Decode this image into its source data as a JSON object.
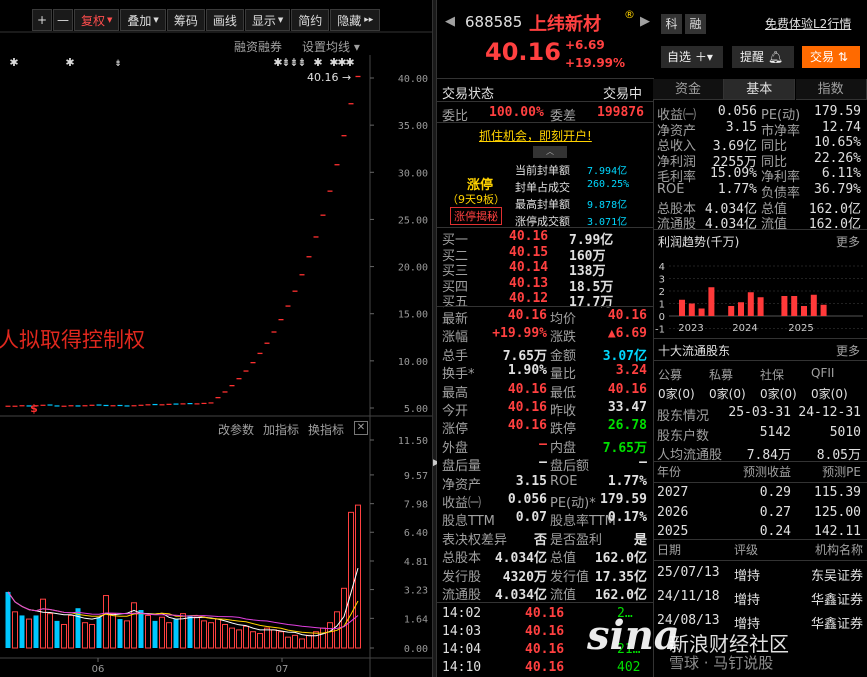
{
  "toolbar": {
    "add": "+",
    "minus": "—",
    "fuquan": "复权",
    "diejia": "叠加",
    "chouma": "筹码",
    "huaxian": "画线",
    "xianshi": "显示",
    "jianyue": "简约",
    "yincang": "隐藏",
    "more": "▸▸"
  },
  "chart": {
    "rzrq": "融资融券",
    "junxian": "设置均线",
    "price_label": "40.16",
    "annotation": "人拟取得控制权",
    "y_axis": [
      "40.00",
      "35.00",
      "30.00",
      "25.00",
      "20.00",
      "15.00",
      "10.00",
      "5.00"
    ],
    "sub_buttons": [
      "改参数",
      "加指标",
      "换指标"
    ],
    "sub_y_axis": [
      "11.50",
      "9.57",
      "7.98",
      "6.40",
      "4.81",
      "3.23",
      "1.64",
      "0.00"
    ],
    "x_labels": [
      "06",
      "07"
    ],
    "closes": [
      5.25,
      5.25,
      5.3,
      5.2,
      5.3,
      5.35,
      5.3,
      5.2,
      5.25,
      5.3,
      5.2,
      5.3,
      5.35,
      5.3,
      5.25,
      5.3,
      5.25,
      5.2,
      5.3,
      5.35,
      5.4,
      5.35,
      5.4,
      5.45,
      5.4,
      5.5,
      5.45,
      5.5,
      5.55,
      5.6,
      6.1,
      6.7,
      7.37,
      8.11,
      8.92,
      9.81,
      10.79,
      11.87,
      13.06,
      14.37,
      15.81,
      17.39,
      19.13,
      21.04,
      23.14,
      25.45,
      28.0,
      30.8,
      33.88,
      37.27,
      40.16
    ],
    "volumes": [
      3.1,
      2.0,
      1.8,
      1.6,
      1.8,
      2.7,
      1.9,
      1.5,
      1.3,
      1.8,
      2.2,
      1.4,
      1.3,
      1.7,
      2.9,
      1.9,
      1.6,
      1.5,
      2.5,
      2.1,
      1.8,
      1.5,
      1.7,
      1.4,
      1.6,
      1.9,
      1.8,
      1.7,
      1.5,
      1.4,
      1.6,
      1.3,
      1.1,
      1.0,
      1.2,
      0.9,
      0.8,
      1.1,
      1.0,
      0.9,
      0.6,
      0.7,
      0.5,
      0.7,
      0.9,
      1.1,
      1.4,
      2.0,
      3.3,
      7.5,
      7.9
    ],
    "vol_up": [
      false,
      true,
      false,
      true,
      false,
      true,
      true,
      false,
      true,
      true,
      false,
      true,
      true,
      false,
      true,
      true,
      false,
      true,
      true,
      false,
      true,
      false,
      true,
      true,
      false,
      true,
      false,
      true,
      true,
      true,
      true,
      true,
      true,
      true,
      true,
      true,
      true,
      true,
      true,
      true,
      true,
      true,
      true,
      true,
      true,
      true,
      true,
      true,
      true,
      true,
      true
    ]
  },
  "header": {
    "code": "688585",
    "name": "上纬新材",
    "ke": "科",
    "rong": "融",
    "free_l2": "免费体验L2行情",
    "price": "40.16",
    "change": "+6.69",
    "pct": "+19.99%",
    "zixuan": "自选",
    "tixing": "提醒",
    "jiaoyi": "交易"
  },
  "status": {
    "label": "交易状态",
    "value": "交易中",
    "weibi_l": "委比",
    "weibi_v": "100.00%",
    "weicha_l": "委差",
    "weicha_v": "199876",
    "promo": "抓住机会，即刻开户!"
  },
  "limit": {
    "title": "涨停",
    "sub": "（9天9板）",
    "btn": "涨停揭秘",
    "rows": [
      [
        "当前封单额",
        "7.994亿"
      ],
      [
        "封单占成交",
        "260.25%"
      ],
      [
        "最高封单额",
        "9.878亿"
      ],
      [
        "涨停成交额",
        "3.071亿"
      ]
    ]
  },
  "book": [
    [
      "买一",
      "40.16",
      "7.99亿"
    ],
    [
      "买二",
      "40.15",
      "160万"
    ],
    [
      "买三",
      "40.14",
      "138万"
    ],
    [
      "买四",
      "40.13",
      "18.5万"
    ],
    [
      "买五",
      "40.12",
      "17.7万"
    ]
  ],
  "stats": [
    [
      [
        "最新",
        "40.16",
        "r"
      ],
      [
        "均价",
        "40.16",
        "r"
      ]
    ],
    [
      [
        "涨幅",
        "+19.99%",
        "r"
      ],
      [
        "涨跌",
        "▲6.69",
        "r"
      ]
    ],
    [
      [
        "总手",
        "7.65万",
        "w"
      ],
      [
        "金额",
        "3.07亿",
        "c"
      ]
    ],
    [
      [
        "换手*",
        "1.90%",
        "w"
      ],
      [
        "量比",
        "3.24",
        "r"
      ]
    ],
    [
      [
        "最高",
        "40.16",
        "r"
      ],
      [
        "最低",
        "40.16",
        "r"
      ]
    ],
    [
      [
        "今开",
        "40.16",
        "r"
      ],
      [
        "昨收",
        "33.47",
        "w"
      ]
    ],
    [
      [
        "涨停",
        "40.16",
        "r"
      ],
      [
        "跌停",
        "26.78",
        "g"
      ]
    ],
    [
      [
        "外盘",
        "—",
        "r"
      ],
      [
        "内盘",
        "7.65万",
        "g"
      ]
    ],
    [
      [
        "盘后量",
        "—",
        "w"
      ],
      [
        "盘后额",
        "—",
        "w"
      ]
    ],
    [
      [
        "净资产",
        "3.15",
        "w"
      ],
      [
        "ROE",
        "1.77%",
        "w"
      ]
    ],
    [
      [
        "收益㈠",
        "0.056",
        "w"
      ],
      [
        "PE(动)*",
        "179.59",
        "w"
      ]
    ],
    [
      [
        "股息TTM",
        "0.07",
        "w"
      ],
      [
        "股息率TTM",
        "0.17%",
        "w"
      ]
    ],
    [
      [
        "表决权差异",
        "否",
        "w"
      ],
      [
        "是否盈利",
        "是",
        "w"
      ]
    ],
    [
      [
        "总股本",
        "4.034亿",
        "w"
      ],
      [
        "总值",
        "162.0亿",
        "w"
      ]
    ],
    [
      [
        "发行股",
        "4320万",
        "w"
      ],
      [
        "发行值",
        "17.35亿",
        "w"
      ]
    ],
    [
      [
        "流通股",
        "4.034亿",
        "w"
      ],
      [
        "流值",
        "162.0亿",
        "w"
      ]
    ]
  ],
  "ticks": [
    [
      "14:02",
      "40.16",
      "2…"
    ],
    [
      "14:03",
      "40.16",
      ""
    ],
    [
      "14:04",
      "40.16",
      "21…"
    ],
    [
      "14:10",
      "40.16",
      "402"
    ]
  ],
  "tabs": [
    "资金",
    "基本",
    "指数"
  ],
  "basic": [
    [
      "收益㈠",
      "0.056",
      "PE(动)",
      "179.59"
    ],
    [
      "净资产",
      "3.15",
      "市净率",
      "12.74"
    ],
    [
      "总收入",
      "3.69亿",
      "同比",
      "10.65%"
    ],
    [
      "净利润",
      "2255万",
      "同比",
      "22.26%"
    ],
    [
      "毛利率",
      "15.09%",
      "净利率",
      "6.11%"
    ],
    [
      "ROE",
      "1.77%",
      "负债率",
      "36.79%"
    ],
    [
      "总股本",
      "4.034亿",
      "总值",
      "162.0亿"
    ],
    [
      "流通股",
      "4.034亿",
      "流值",
      "162.0亿"
    ]
  ],
  "profit": {
    "title": "利润趋势(千万)",
    "more": "更多",
    "y": [
      "4",
      "3",
      "2",
      "1",
      "0",
      "-1"
    ],
    "x": [
      "2023",
      "2024",
      "2025"
    ],
    "values": [
      1.3,
      1.0,
      0.6,
      2.3,
      0.8,
      1.1,
      1.9,
      1.5,
      1.6,
      1.6,
      0.8,
      1.7,
      0.9
    ]
  },
  "holders": {
    "title": "十大流通股东",
    "more": "更多",
    "types": [
      "公募",
      "私募",
      "社保",
      "QFII"
    ],
    "counts": [
      "0家(0)",
      "0家(0)",
      "0家(0)",
      "0家(0)"
    ],
    "rows": [
      [
        "股东情况",
        "25-03-31",
        "24-12-31"
      ],
      [
        "股东户数",
        "5142",
        "5010"
      ],
      [
        "人均流通股",
        "7.84万",
        "8.05万"
      ]
    ]
  },
  "forecast": {
    "headers": [
      "年份",
      "预测收益",
      "预测PE"
    ],
    "rows": [
      [
        "2027",
        "0.29",
        "115.39"
      ],
      [
        "2026",
        "0.27",
        "125.00"
      ],
      [
        "2025",
        "0.24",
        "142.11"
      ]
    ]
  },
  "ratings": {
    "headers": [
      "日期",
      "评级",
      "机构名称"
    ],
    "rows": [
      [
        "25/07/13",
        "增持",
        "东吴证券"
      ],
      [
        "24/11/18",
        "增持",
        "华鑫证券"
      ],
      [
        "24/08/13",
        "增持",
        "华鑫证券"
      ]
    ]
  },
  "watermark": {
    "brand": "新浪财经社区",
    "author": "雪球 · 马钉说股"
  }
}
